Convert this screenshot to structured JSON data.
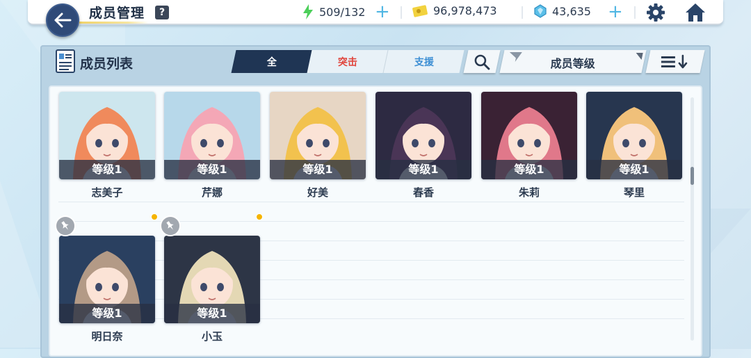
{
  "header": {
    "title": "成员管理",
    "help": "?",
    "stamina": "509/132",
    "credits": "96,978,473",
    "gems": "43,635"
  },
  "panel": {
    "title": "成员列表",
    "tabs": [
      {
        "label": "全"
      },
      {
        "label": "突击"
      },
      {
        "label": "支援"
      }
    ],
    "sort_label": "成员等级"
  },
  "members": [
    {
      "name": "志美子",
      "level": "等级1",
      "hair": "#f08a5c",
      "bg": "#cde6ee"
    },
    {
      "name": "芹娜",
      "level": "等级1",
      "hair": "#f4a7b6",
      "bg": "#b7d8ea"
    },
    {
      "name": "好美",
      "level": "等级1",
      "hair": "#f2c24e",
      "bg": "#e7d6c4"
    },
    {
      "name": "春香",
      "level": "等级1",
      "hair": "#4a3556",
      "bg": "#2d2a42"
    },
    {
      "name": "朱莉",
      "level": "等级1",
      "hair": "#e0788a",
      "bg": "#3a2234"
    },
    {
      "name": "琴里",
      "level": "等级1",
      "hair": "#f0c07a",
      "bg": "#27364f"
    },
    {
      "name": "明日奈",
      "level": "等级1",
      "hair": "#b39a86",
      "bg": "#2a4060"
    },
    {
      "name": "小玉",
      "level": "等级1",
      "hair": "#e4d8b4",
      "bg": "#2d3546"
    }
  ],
  "colors": {
    "accent": "#1f3554",
    "raid": "#e0443b",
    "support": "#3d8fd4",
    "plus": "#4fb6e3",
    "new_dot": "#f5b400"
  }
}
